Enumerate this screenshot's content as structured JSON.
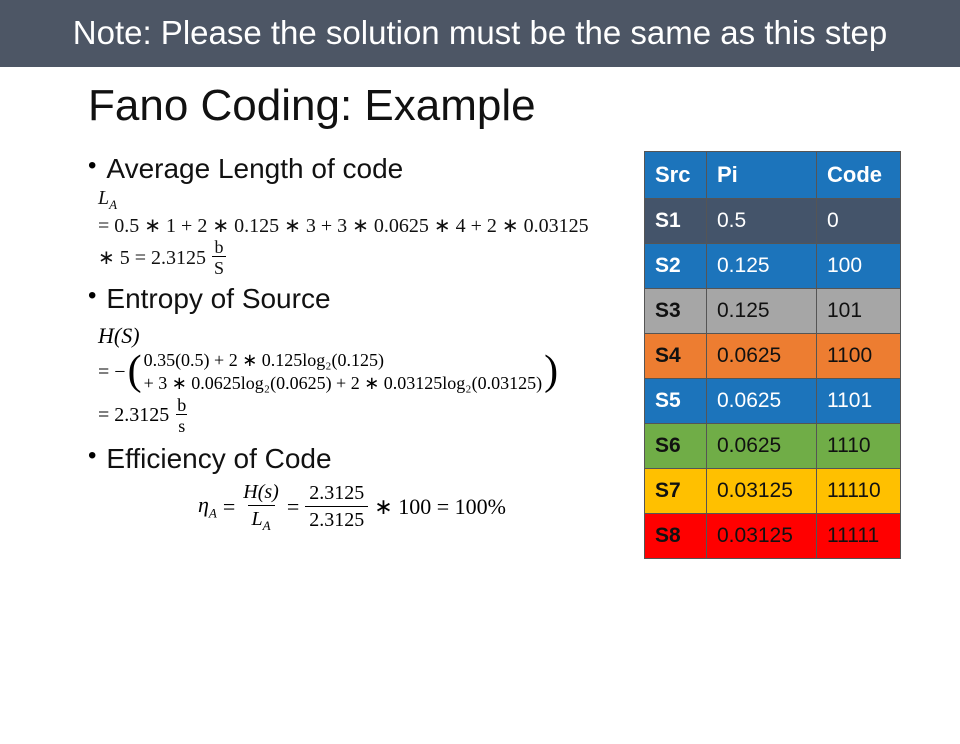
{
  "header_note": "Note: Please the solution must be the same as this step",
  "title": "Fano Coding: Example",
  "bullets": {
    "avg_length": "Average Length of code",
    "entropy": "Entropy of Source",
    "efficiency": "Efficiency of Code"
  },
  "avg_length_math": {
    "la": "L",
    "la_sub": "A",
    "line1": "= 0.5 ∗ 1 + 2 ∗ 0.125 ∗ 3 + 3 ∗ 0.0625 ∗ 4 + 2 ∗ 0.03125",
    "line2_prefix": "∗ 5 = 2.3125",
    "frac_num": "b",
    "frac_den": "S"
  },
  "entropy_math": {
    "hs": "H(S)",
    "eq_neg": "= −",
    "p1": "0.35(0.5) + 2 ∗ 0.125log₂(0.125)",
    "p2": "+ 3 ∗ 0.0625log₂(0.0625) + 2 ∗ 0.03125log₂(0.03125)",
    "result_prefix": "= 2.3125",
    "frac_num": "b",
    "frac_den": "s"
  },
  "efficiency_math": {
    "eta": "η",
    "eta_sub": "A",
    "eq": "=",
    "frac1_num": "H(s)",
    "frac1_den_l": "L",
    "frac1_den_sub": "A",
    "frac2_num": "2.3125",
    "frac2_den": "2.3125",
    "tail": "∗ 100 = 100%"
  },
  "table": {
    "headers": {
      "src": "Src",
      "pi": "Pi",
      "code": "Code"
    },
    "rows": [
      {
        "src": "S1",
        "pi": "0.5",
        "code": "0",
        "cls": "row-s1"
      },
      {
        "src": "S2",
        "pi": "0.125",
        "code": "100",
        "cls": "row-s2"
      },
      {
        "src": "S3",
        "pi": "0.125",
        "code": "101",
        "cls": "row-s3"
      },
      {
        "src": "S4",
        "pi": "0.0625",
        "code": "1100",
        "cls": "row-s4"
      },
      {
        "src": "S5",
        "pi": "0.0625",
        "code": "1101",
        "cls": "row-s5"
      },
      {
        "src": "S6",
        "pi": "0.0625",
        "code": "1110",
        "cls": "row-s6"
      },
      {
        "src": "S7",
        "pi": "0.03125",
        "code": "11110",
        "cls": "row-s7"
      },
      {
        "src": "S8",
        "pi": "0.03125",
        "code": "11111",
        "cls": "row-s8"
      }
    ]
  }
}
